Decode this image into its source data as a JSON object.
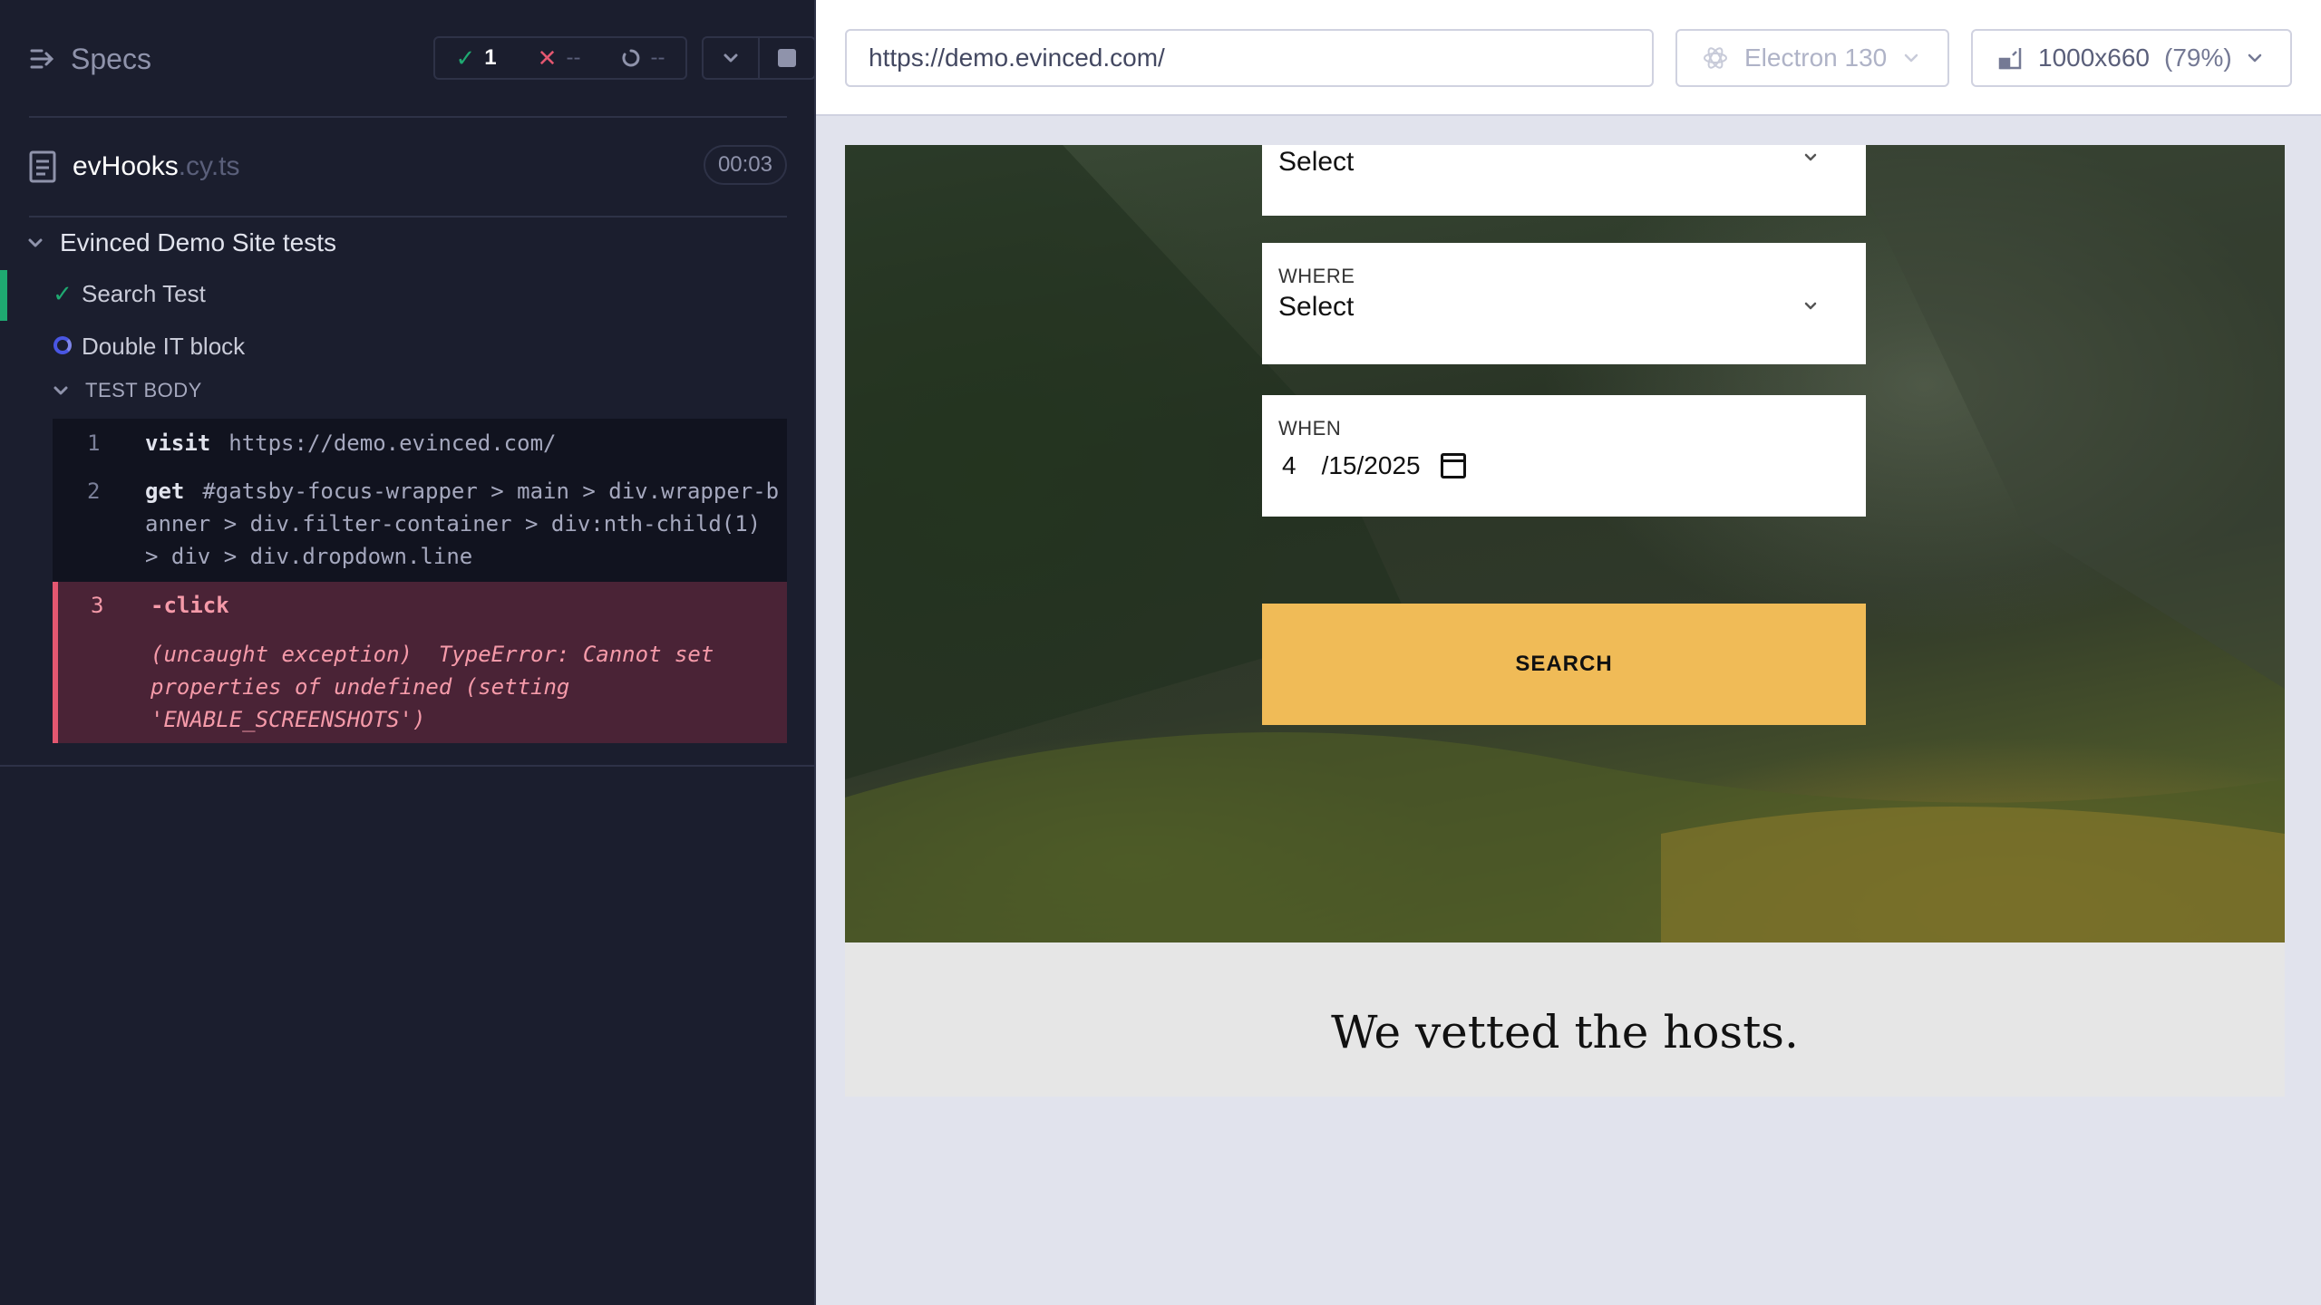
{
  "reporter": {
    "specs_label": "Specs",
    "stats": {
      "passed": "1",
      "failed": "--",
      "pending": "--"
    },
    "file": {
      "name": "evHooks",
      "ext": ".cy.ts",
      "duration": "00:03"
    },
    "suite": "Evinced Demo Site tests",
    "tests": [
      {
        "title": "Search Test",
        "state": "passed"
      },
      {
        "title": "Double IT block",
        "state": "running"
      }
    ],
    "body_header": "TEST BODY",
    "commands": [
      {
        "num": "1",
        "name": "visit",
        "message": "https://demo.evinced.com/"
      },
      {
        "num": "2",
        "name": "get",
        "message": "#gatsby-focus-wrapper > main > div.wrapper-banner > div.filter-container > div:nth-child(1) > div > div.dropdown.line"
      },
      {
        "num": "3",
        "name": "-click",
        "message": "(uncaught exception)  TypeError: Cannot set properties of undefined (setting 'ENABLE_SCREENSHOTS')"
      }
    ]
  },
  "aut": {
    "url": "https://demo.evinced.com/",
    "browser": "Electron 130",
    "viewport": "1000x660",
    "scale": "(79%)",
    "page": {
      "top_select_value": "Select",
      "where_label": "WHERE",
      "where_value": "Select",
      "when_label": "WHEN",
      "date_month": "4",
      "date_day": "/15",
      "date_year": "/2025",
      "search_label": "SEARCH",
      "hosts_heading": "We vetted the hosts."
    }
  },
  "colors": {
    "pass": "#1fa971",
    "fail": "#e45770",
    "search_button": "#f0bb57",
    "reporter_bg": "#1b1e2e"
  },
  "icons": [
    "menu-collapse-icon",
    "check-icon",
    "x-icon",
    "spinner-icon",
    "chevron-down-icon",
    "stop-icon",
    "file-icon",
    "electron-icon",
    "viewport-icon",
    "calendar-icon"
  ]
}
